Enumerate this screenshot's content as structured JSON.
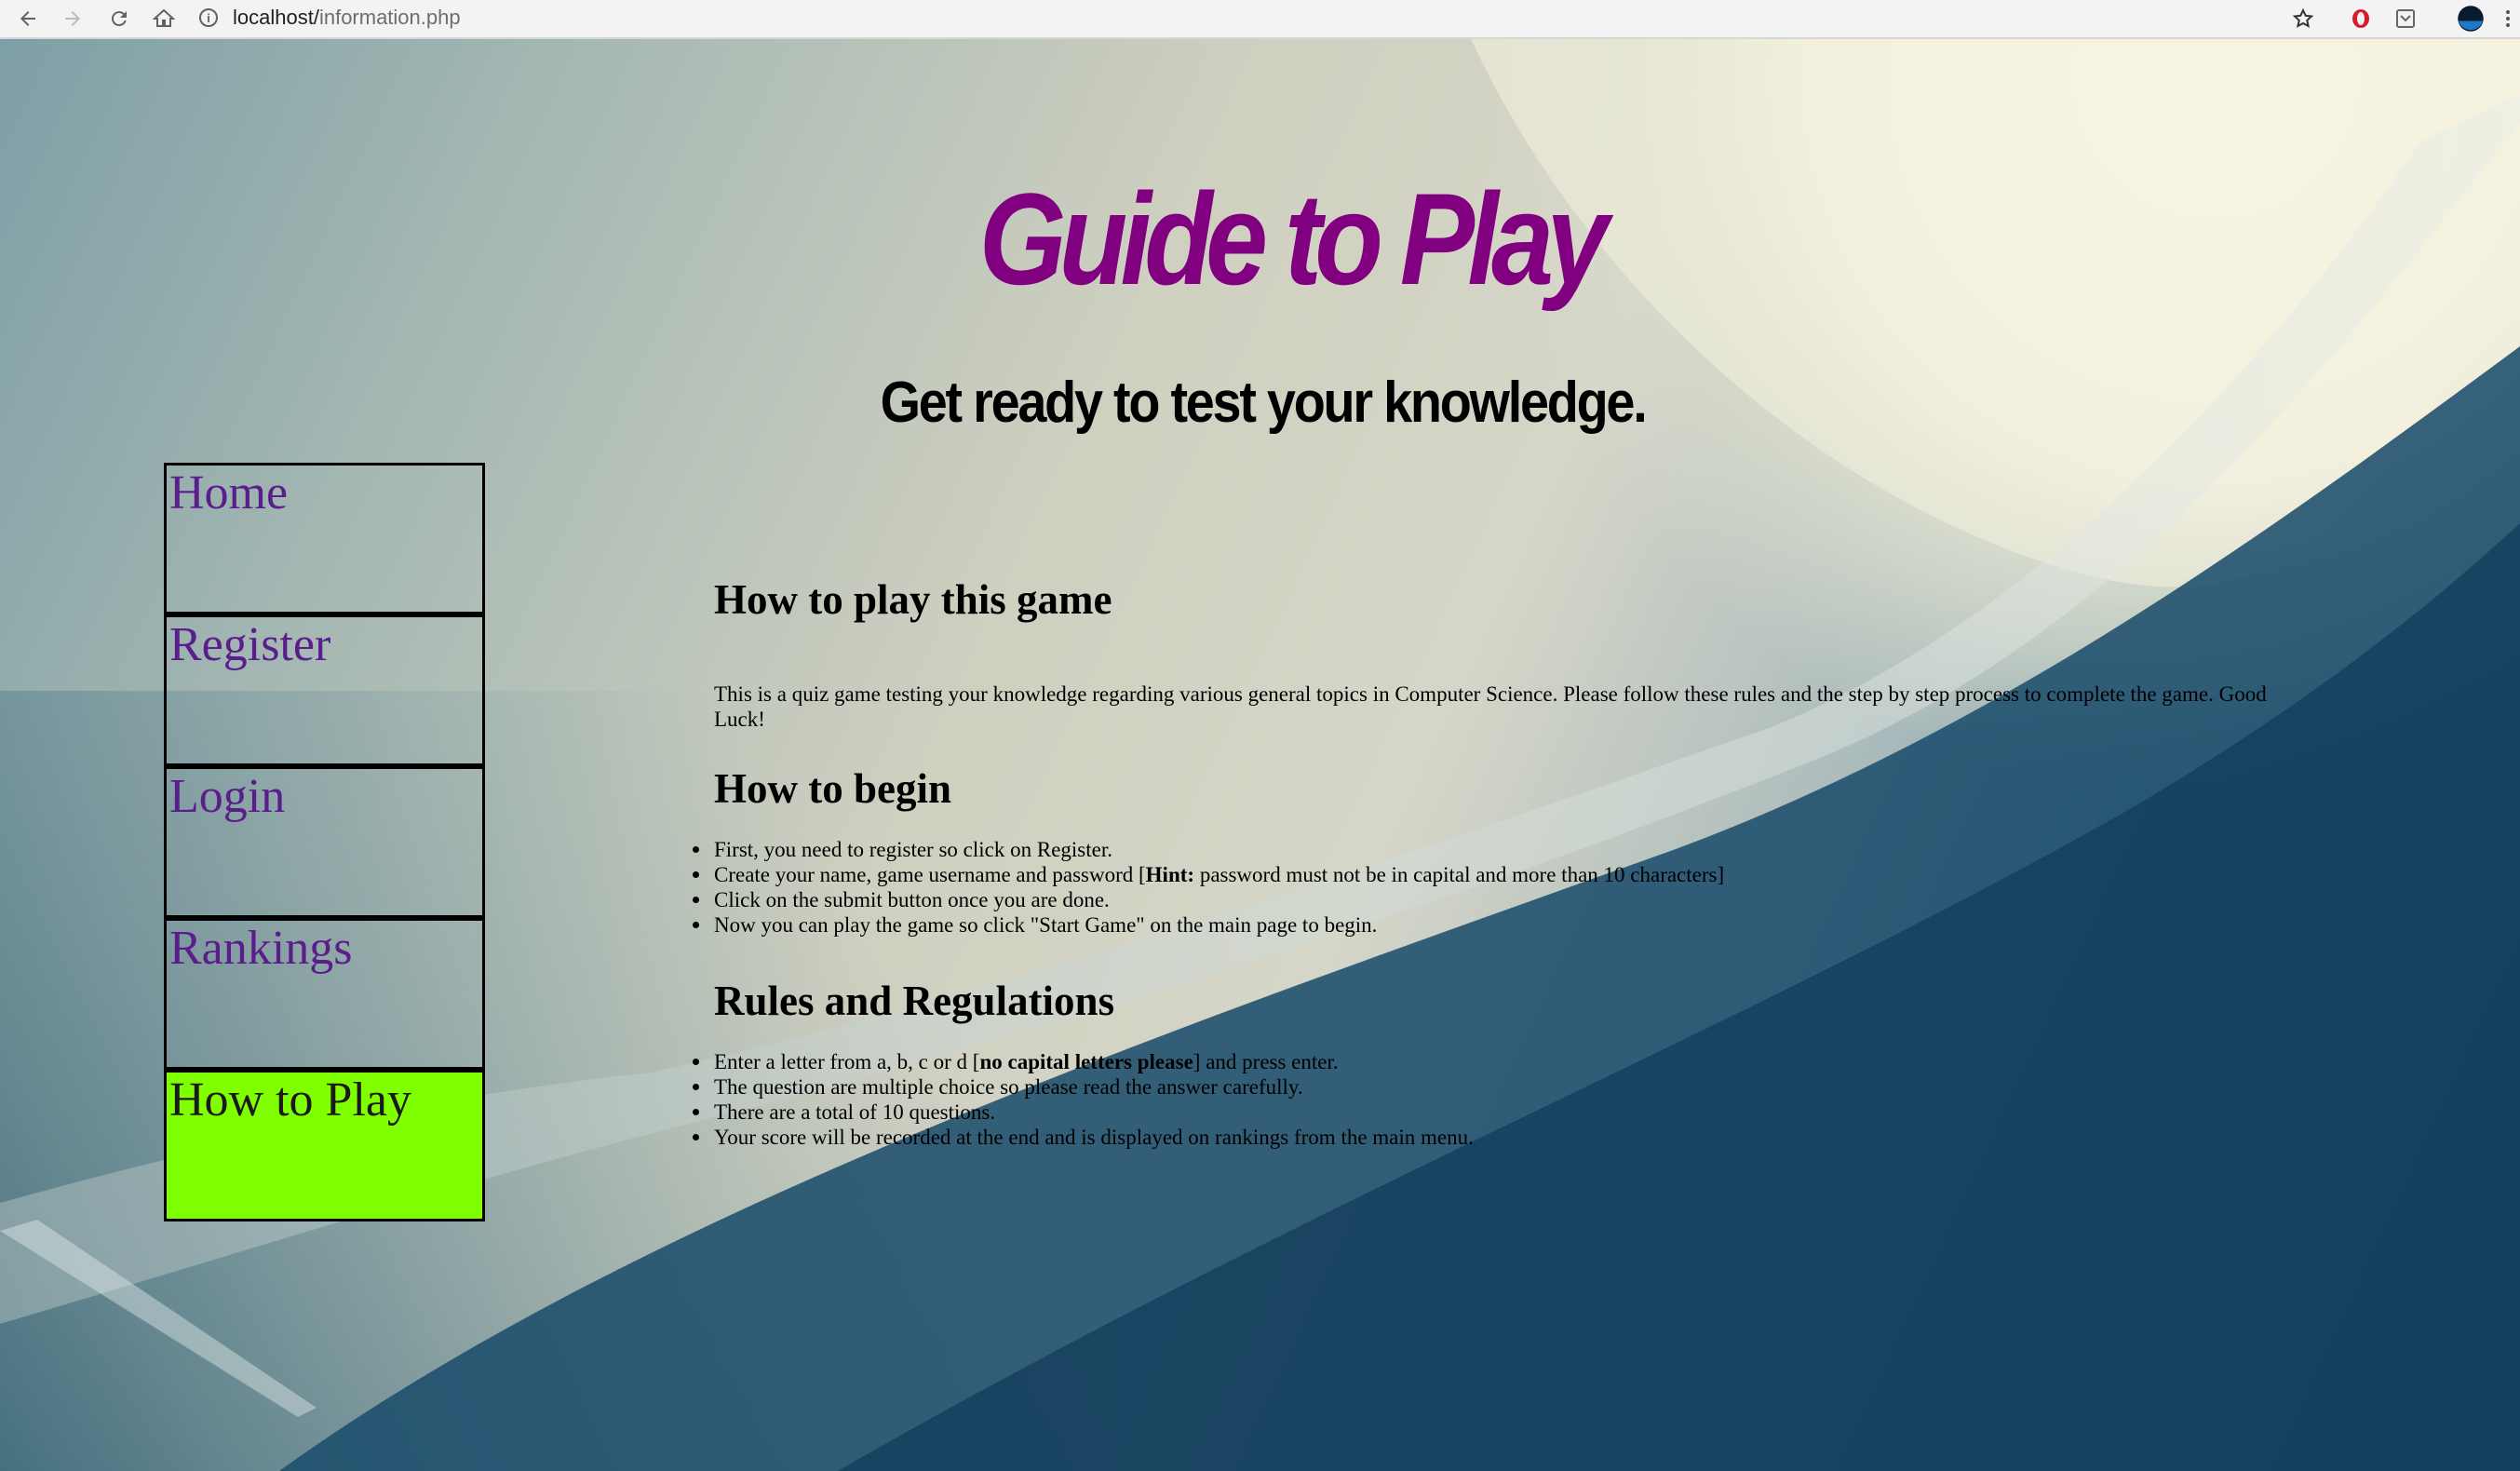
{
  "browser": {
    "url_host": "localhost/",
    "url_path": "information.php"
  },
  "header": {
    "title": "Guide to Play",
    "subtitle": "Get ready to test your knowledge."
  },
  "nav": {
    "items": [
      {
        "label": "Home",
        "active": false
      },
      {
        "label": "Register",
        "active": false
      },
      {
        "label": "Login",
        "active": false
      },
      {
        "label": "Rankings",
        "active": false
      },
      {
        "label": "How to Play",
        "active": true
      }
    ]
  },
  "content": {
    "section1": {
      "heading": "How to play this game",
      "paragraph": "This is a quiz game testing your knowledge regarding various general topics in Computer Science. Please follow these rules and the step by step process to complete the game. Good Luck!"
    },
    "section2": {
      "heading": "How to begin",
      "items": [
        {
          "text": "First, you need to register so click on Register."
        },
        {
          "before": "Create your name, game username and password [",
          "bold": "Hint:",
          "after": " password must not be in capital and more than 10 characters]"
        },
        {
          "text": "Click on the submit button once you are done."
        },
        {
          "text": "Now you can play the game so click \"Start Game\" on the main page to begin."
        }
      ]
    },
    "section3": {
      "heading": "Rules and Regulations",
      "items": [
        {
          "before": "Enter a letter from a, b, c or d [",
          "bold": "no capital letters please",
          "after": "] and press enter."
        },
        {
          "text": "The question are multiple choice so please read the answer carefully."
        },
        {
          "text": "There are a total of 10 questions."
        },
        {
          "text": "Your score will be recorded at the end and is displayed on rankings from the main menu."
        }
      ]
    }
  },
  "colors": {
    "title": "#800080",
    "nav_text": "#5a1e8c",
    "nav_active_bg": "#7fff00"
  }
}
